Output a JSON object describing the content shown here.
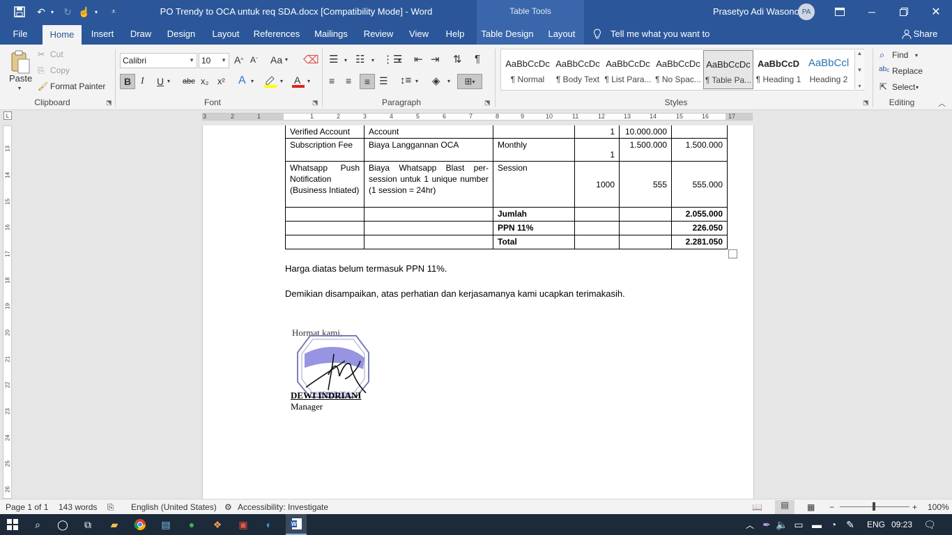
{
  "titlebar": {
    "doc_title": "PO Trendy  to OCA untuk req SDA.docx [Compatibility Mode]  -  Word",
    "table_tools": "Table Tools",
    "user_name": "Prasetyo Adi Wasono",
    "user_initials": "PA"
  },
  "tabs": [
    "File",
    "Home",
    "Insert",
    "Draw",
    "Design",
    "Layout",
    "References",
    "Mailings",
    "Review",
    "View",
    "Help",
    "Table Design",
    "Layout"
  ],
  "tell_me": "Tell me what you want to do",
  "share": "Share",
  "clipboard": {
    "paste": "Paste",
    "cut": "Cut",
    "copy": "Copy",
    "format_painter": "Format Painter",
    "label": "Clipboard"
  },
  "font": {
    "family": "Calibri",
    "size": "10",
    "label": "Font",
    "bold": "B",
    "italic": "I",
    "underline": "U",
    "strike": "abc",
    "sub": "x₂",
    "sup": "x²",
    "case": "Aa"
  },
  "paragraph": {
    "label": "Paragraph"
  },
  "styles": {
    "label": "Styles",
    "items": [
      {
        "preview": "AaBbCcDc",
        "name": "¶ Normal"
      },
      {
        "preview": "AaBbCcDc",
        "name": "¶ Body Text"
      },
      {
        "preview": "AaBbCcDc",
        "name": "¶ List Para..."
      },
      {
        "preview": "AaBbCcDc",
        "name": "¶ No Spac..."
      },
      {
        "preview": "AaBbCcDc",
        "name": "¶ Table Pa..."
      },
      {
        "preview": "AaBbCcD",
        "name": "¶ Heading 1"
      },
      {
        "preview": "AaBbCcl",
        "name": "Heading 2"
      }
    ]
  },
  "editing": {
    "find": "Find",
    "replace": "Replace",
    "select": "Select",
    "label": "Editing"
  },
  "ruler_numbers": [
    "3",
    "2",
    "1",
    "1",
    "2",
    "3",
    "4",
    "5",
    "6",
    "7",
    "8",
    "9",
    "10",
    "11",
    "12",
    "13",
    "14",
    "15",
    "16",
    "17"
  ],
  "vruler_numbers": [
    "13",
    "14",
    "15",
    "16",
    "17",
    "18",
    "19",
    "20",
    "21",
    "22",
    "23",
    "24",
    "25",
    "26"
  ],
  "table": {
    "rows": [
      {
        "c1": "Verified Account",
        "c2": "Account",
        "c3": "",
        "c4": "1",
        "c5": "10.000.000",
        "c6": ""
      },
      {
        "c1": "Subscription Fee",
        "c2": "Biaya Langgannan OCA",
        "c3": "Monthly",
        "c4": "1",
        "c5": "1.500.000",
        "c6": "1.500.000"
      },
      {
        "c1": "Whatsapp Push Notification (Business Intiated)",
        "c2": "Biaya Whatsapp Blast per-session untuk 1 unique number (1 session = 24hr)",
        "c3": "Session",
        "c4": "1000",
        "c5": "555",
        "c6": "555.000"
      },
      {
        "c1": "",
        "c2": "",
        "c3": "Jumlah",
        "c4": "",
        "c5": "",
        "c6": "2.055.000"
      },
      {
        "c1": "",
        "c2": "",
        "c3": "PPN 11%",
        "c4": "",
        "c5": "",
        "c6": "226.050"
      },
      {
        "c1": "",
        "c2": "",
        "c3": "Total",
        "c4": "",
        "c5": "",
        "c6": "2.281.050"
      }
    ]
  },
  "body": {
    "note": "Harga diatas belum termasuk PPN 11%.",
    "closing": "Demikian disampaikan, atas perhatian dan kerjasamanya kami ucapkan terimakasih.",
    "regards": "Hormat kami,",
    "stamp_text": "KOPKAR SDA",
    "signer": "DEWI INDRIANI",
    "signer_title": "Manager"
  },
  "status": {
    "page": "Page 1 of 1",
    "words": "143 words",
    "language": "English (United States)",
    "accessibility": "Accessibility: Investigate",
    "zoom": "100%"
  },
  "taskbar": {
    "lang": "ENG",
    "time": "09:23"
  }
}
